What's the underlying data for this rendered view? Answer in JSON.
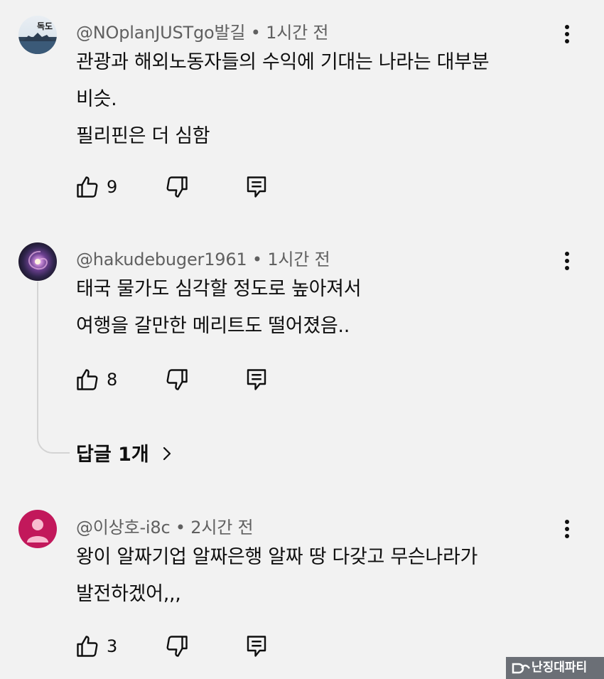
{
  "comments": [
    {
      "handle": "@NOplanJUSTgo발길",
      "time": "1시간 전",
      "lines": [
        "관광과 해외노동자들의 수익에 기대는 나라는 대부분",
        "비슷.",
        "필리핀은 더 심함"
      ],
      "likes": "9",
      "avatar_text": "독도"
    },
    {
      "handle": "@hakudebuger1961",
      "time": "1시간 전",
      "lines": [
        "태국 물가도 심각할 정도로 높아져서",
        "여행을 갈만한 메리트도 떨어졌음.."
      ],
      "likes": "8",
      "replies_label": "답글 1개"
    },
    {
      "handle": "@이상호-i8c",
      "time": "2시간 전",
      "lines": [
        "왕이 알짜기업 알짜은행 알짜 땅 다갖고  무슨나라가",
        "발전하겠어,,,"
      ],
      "likes": "3"
    }
  ],
  "separator": "•",
  "icons": {
    "like": "thumbs-up-icon",
    "dislike": "thumbs-down-icon",
    "reply": "reply-comment-icon",
    "more": "more-vertical-icon",
    "expand": "chevron-right-icon"
  },
  "colors": {
    "background": "#f2f2f2",
    "text": "#0f0f0f",
    "meta": "#606060",
    "avatar_pink": "#c2185b"
  },
  "watermark": "난징대파티"
}
